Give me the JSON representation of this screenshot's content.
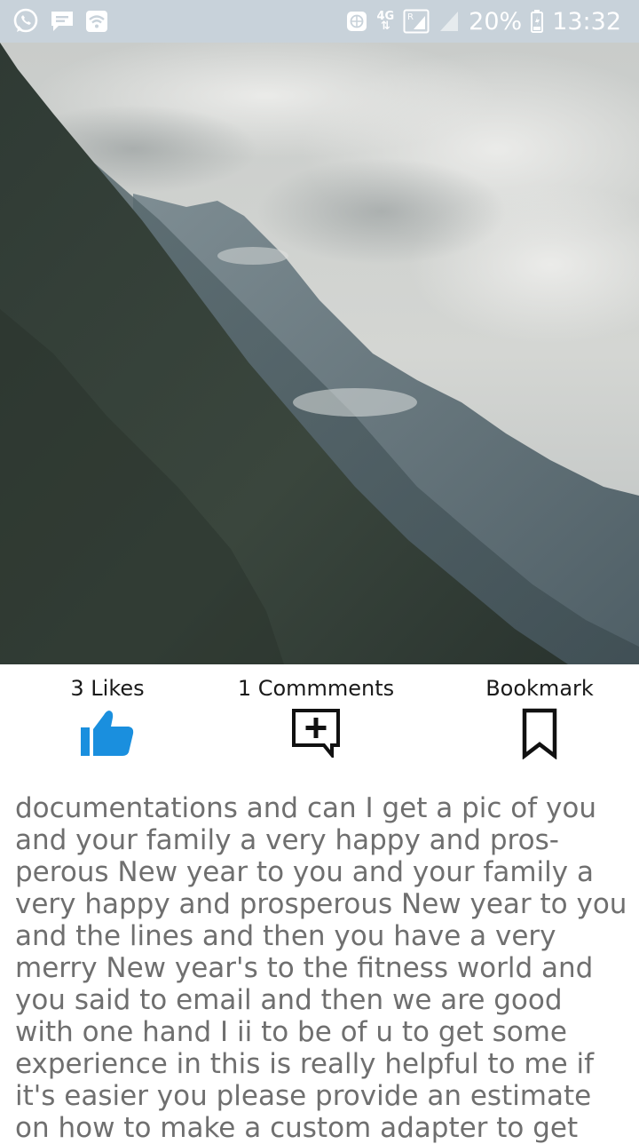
{
  "status_bar": {
    "battery": "20%",
    "time": "13:32",
    "network": "4G",
    "icons": [
      "whatsapp-icon",
      "message-icon",
      "wifi-icon",
      "vpn-icon",
      "network-4g-icon",
      "signal-r-icon",
      "signal-icon",
      "battery-icon"
    ]
  },
  "post": {
    "image": "mountain-photo",
    "likes_label": "3 Likes",
    "comments_label": "1 Commments",
    "bookmark_label": "Bookmark",
    "like_icon": "thumbs-up-icon",
    "comment_icon": "add-comment-icon",
    "bookmark_icon": "bookmark-icon",
    "accent_color": "#1a8fde",
    "body": "documentations and can I get a pic of you and your family a very happy and pros- perous New year to you and your family a very happy and prosperous New year to you and the lines and then you have a very merry New year's to the fitness world and you said to email and then we are good with one hand I ii to be of u to get some experience in this is really helpful to me if it's easier you please provide an estimate on how to make a custom adapter to get"
  }
}
